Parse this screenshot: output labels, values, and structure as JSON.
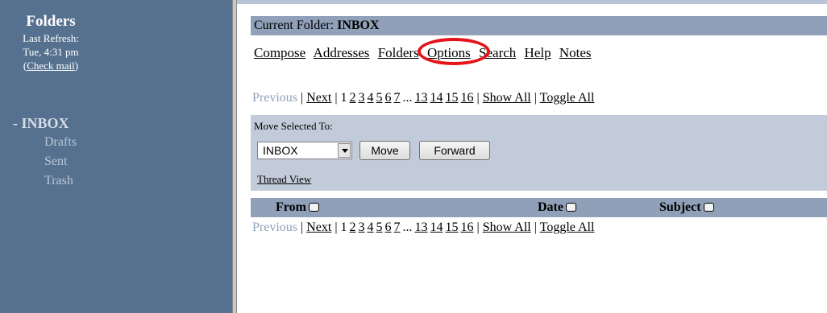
{
  "sidebar": {
    "title": "Folders",
    "last_refresh_label": "Last Refresh:",
    "last_refresh_time": "Tue, 4:31 pm",
    "check_mail_open": "(",
    "check_mail": "Check mail",
    "check_mail_close": ")",
    "folders": [
      {
        "prefix": "- ",
        "name": "INBOX",
        "current": true
      },
      {
        "name": "Drafts"
      },
      {
        "name": "Sent"
      },
      {
        "name": "Trash"
      }
    ]
  },
  "header": {
    "current_folder_label": "Current Folder: ",
    "current_folder": "INBOX"
  },
  "menu": {
    "items": [
      "Compose",
      "Addresses",
      "Folders",
      "Options",
      "Search",
      "Help",
      "Notes"
    ],
    "highlighted": "Options",
    "highlight_color": "#e4141a"
  },
  "pager": {
    "previous": "Previous",
    "separator": " | ",
    "next": "Next",
    "pages_before": [
      "1",
      "2",
      "3",
      "4",
      "5",
      "6",
      "7"
    ],
    "ellipsis": "...",
    "pages_after": [
      "13",
      "14",
      "15",
      "16"
    ],
    "show_all": "Show All",
    "toggle_all": "Toggle All"
  },
  "move": {
    "label": "Move Selected To:",
    "selected_folder": "INBOX",
    "move_button": "Move",
    "forward_button": "Forward",
    "thread_view": "Thread View"
  },
  "columns": {
    "from": "From",
    "date": "Date",
    "subject": "Subject"
  },
  "colors": {
    "sidebar_bg": "#56718f",
    "bar_bg": "#8fa0b8",
    "move_box_bg": "#c2cbd9"
  }
}
